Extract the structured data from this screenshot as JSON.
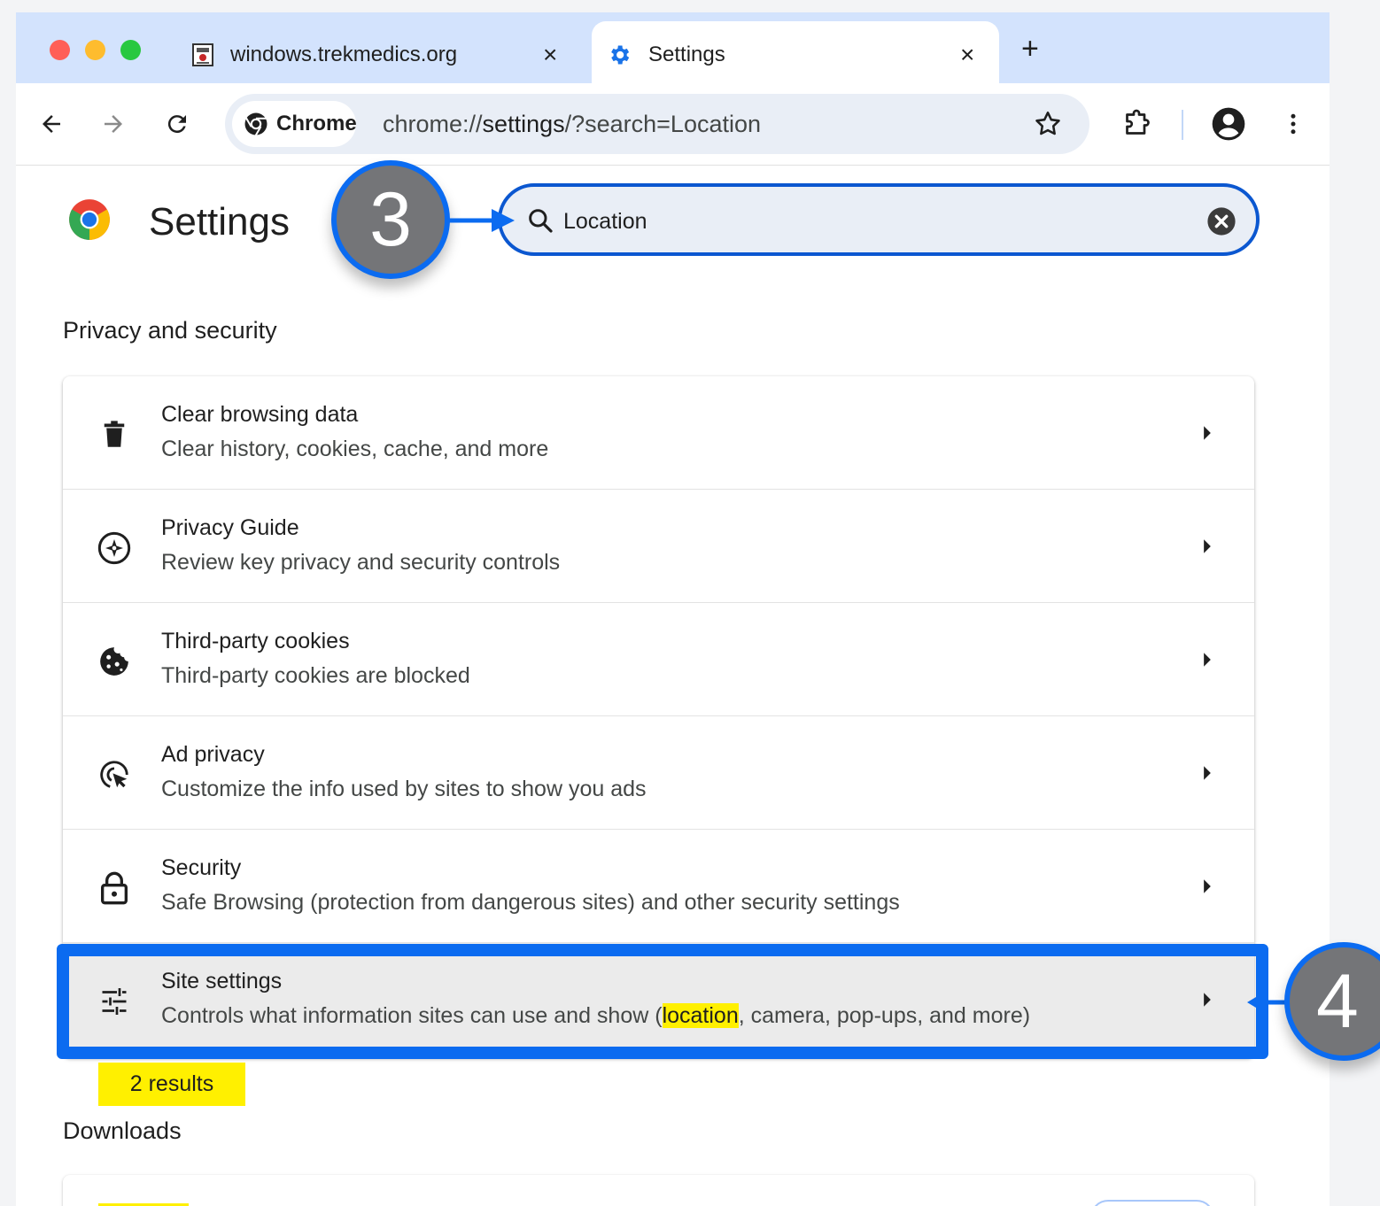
{
  "browser": {
    "tabs": [
      {
        "title": "windows.trekmedics.org",
        "favicon": "trekmedics-icon",
        "active": false
      },
      {
        "title": "Settings",
        "favicon": "gear-icon",
        "active": true
      }
    ],
    "close_glyph": "×",
    "new_tab_glyph": "+",
    "chip_label": "Chrome",
    "url_prefix": "chrome://",
    "url_host": "settings",
    "url_rest": "/?search=Location",
    "accent": "#0b57d0"
  },
  "settings": {
    "title": "Settings",
    "search_value": "Location",
    "section_privacy": "Privacy and security",
    "rows": [
      {
        "title": "Clear browsing data",
        "subtitle": "Clear history, cookies, cache, and more",
        "icon": "trash-icon"
      },
      {
        "title": "Privacy Guide",
        "subtitle": "Review key privacy and security controls",
        "icon": "compass-icon"
      },
      {
        "title": "Third-party cookies",
        "subtitle": "Third-party cookies are blocked",
        "icon": "cookie-icon"
      },
      {
        "title": "Ad privacy",
        "subtitle": "Customize the info used by sites to show you ads",
        "icon": "ad-privacy-icon"
      },
      {
        "title": "Security",
        "subtitle": "Safe Browsing (protection from dangerous sites) and other security settings",
        "icon": "lock-icon"
      },
      {
        "title": "Site settings",
        "subtitle_before": "Controls what information sites can use and show (",
        "subtitle_highlight": "location",
        "subtitle_after": ", camera, pop-ups, and more)",
        "icon": "sliders-icon"
      }
    ],
    "results_badge": "2 results",
    "section_downloads": "Downloads"
  },
  "annotations": {
    "step_3": "3",
    "step_4": "4",
    "color": "#0b6bf0"
  }
}
